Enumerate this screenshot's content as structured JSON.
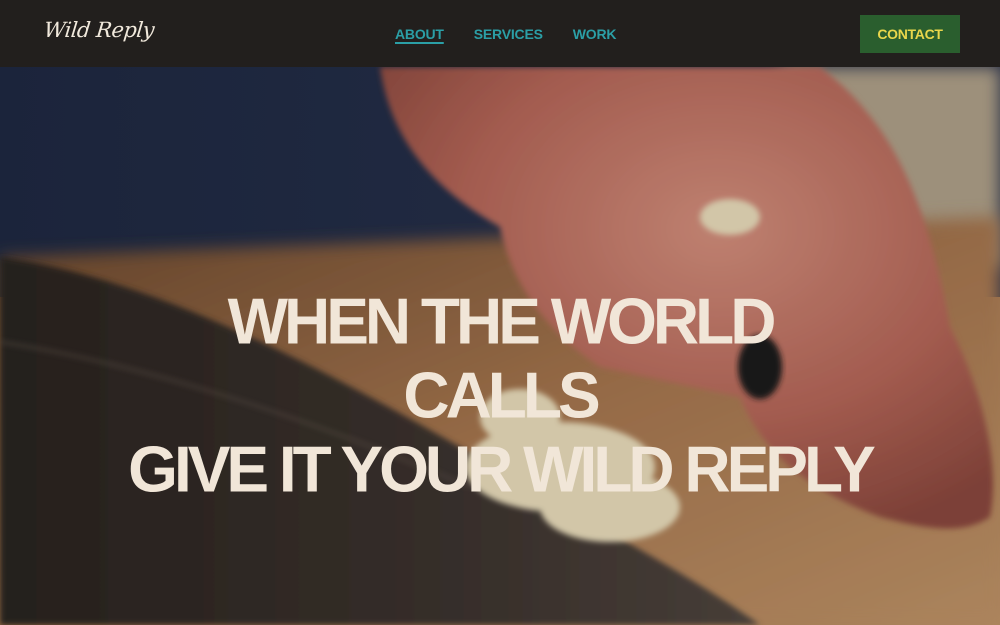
{
  "brand": {
    "logo_text": "Wild Reply"
  },
  "nav": {
    "links": [
      {
        "label": "ABOUT",
        "active": true
      },
      {
        "label": "SERVICES",
        "active": false
      },
      {
        "label": "WORK",
        "active": false
      }
    ],
    "contact_label": "CONTACT"
  },
  "hero": {
    "headline_lines": [
      "WHEN THE WORLD",
      "CALLS",
      "GIVE IT YOUR WILD REPLY"
    ]
  },
  "colors": {
    "nav_bg": "#221f1d",
    "link": "#2b9fa6",
    "contact_bg": "#2a5e2e",
    "contact_text": "#e9d64b",
    "headline": "#f1e6d8"
  }
}
